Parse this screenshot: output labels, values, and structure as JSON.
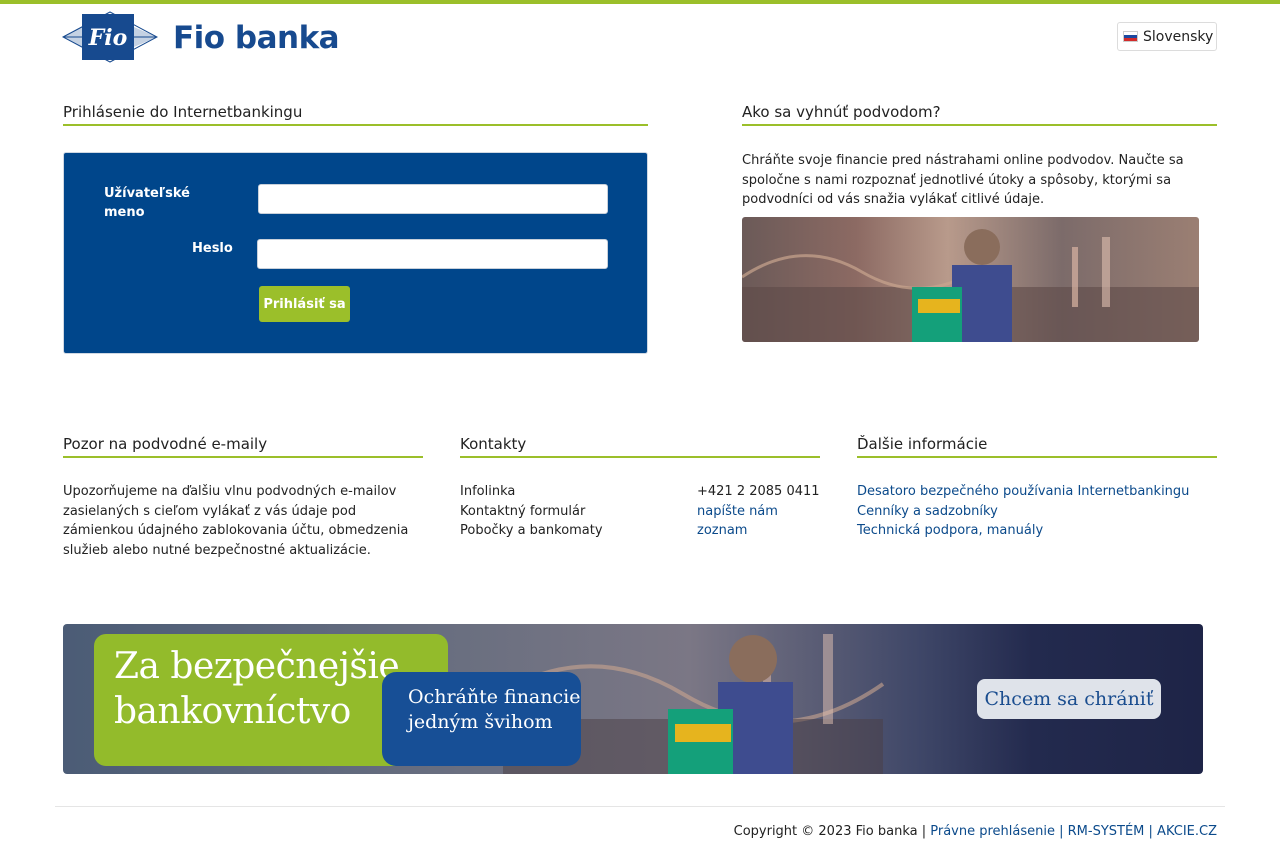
{
  "brand": {
    "logo_emblem_text": "Fio",
    "name": "Fio banka",
    "blue": "#174a8f",
    "green": "#9bbf2a"
  },
  "language": {
    "label": "Slovensky",
    "icon": "slovak-flag-icon"
  },
  "login": {
    "title": "Prihlásenie do Internetbankingu",
    "username_label": "Užívateľské meno",
    "username_value": "",
    "password_label": "Heslo",
    "password_value": "",
    "submit_label": "Prihlásiť sa"
  },
  "fraud": {
    "title": "Ako sa vyhnúť podvodom?",
    "text": "Chráňte svoje financie pred nástrahami online podvodov. Naučte sa spoločne s nami rozpoznať jednotlivé útoky a spôsoby, ktorými sa podvodníci od vás snažia vylákať citlivé údaje."
  },
  "phishing": {
    "title": "Pozor na podvodné e-maily",
    "text": "Upozorňujeme na ďalšiu vlnu podvodných e-mailov zasielaných s cieľom vylákať z vás údaje pod zámienkou údajného zablokovania účtu, obmedzenia služieb alebo nutné bezpečnostné aktualizácie."
  },
  "contacts": {
    "title": "Kontakty",
    "rows": [
      {
        "label": "Infolinka",
        "value": "+421 2 2085 0411"
      },
      {
        "label": "Kontaktný formulár",
        "value": "napíšte nám"
      },
      {
        "label": "Pobočky a bankomaty",
        "value": "zoznam"
      }
    ]
  },
  "more_info": {
    "title": "Ďalšie informácie",
    "links": [
      "Desatoro bezpečného používania Internetbankingu",
      "Cenníky a sadzobníky",
      "Technická podpora, manuály"
    ]
  },
  "banner": {
    "headline_line1": "Za bezpečnejšie",
    "headline_line2": "bankovníctvo",
    "sub_line1": "Ochráňte financie",
    "sub_line2": "jedným švihom",
    "cta": "Chcem sa chrániť"
  },
  "footer": {
    "copyright": "Copyright © 2023 Fio banka |",
    "links": [
      "Právne prehlásenie",
      "RM-SYSTÉM",
      "AKCIE.CZ"
    ],
    "separator": " | "
  }
}
